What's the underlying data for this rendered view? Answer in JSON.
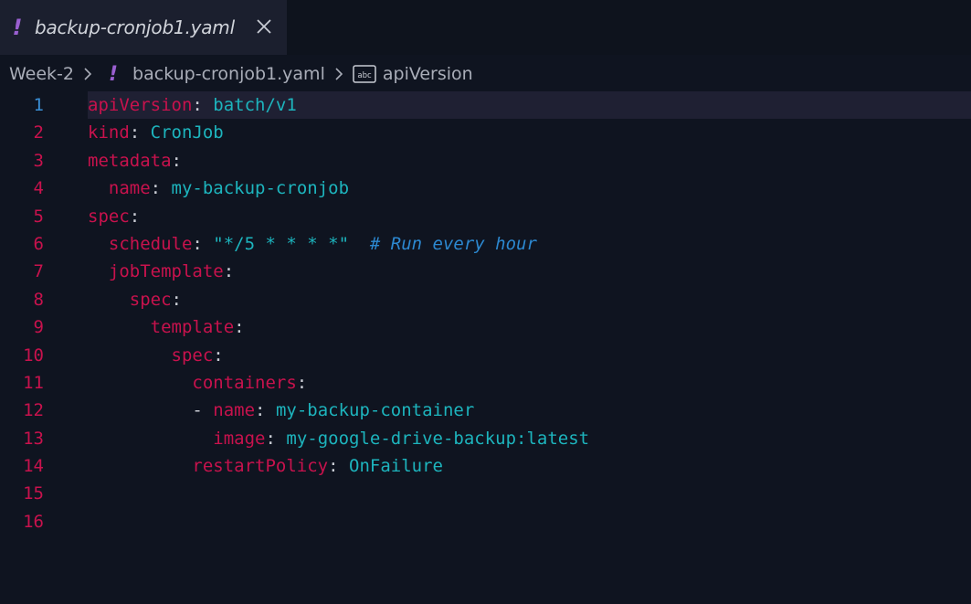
{
  "tab": {
    "icon": "yaml-file-icon",
    "glyph": "!",
    "title": "backup-cronjob1.yaml",
    "close_icon": "close-icon"
  },
  "breadcrumb": {
    "folder": "Week-2",
    "file_glyph": "!",
    "file": "backup-cronjob1.yaml",
    "symbol_icon": "string-symbol-icon",
    "symbol": "apiVersion"
  },
  "colors": {
    "key": "#c8124d",
    "value": "#1db4bd",
    "comment": "#2c88d0",
    "current_line_number": "#3a8fd6",
    "tab_icon": "#9a5fd0",
    "background": "#0f1420"
  },
  "editor": {
    "current_line": 1,
    "lines": [
      {
        "num": "1",
        "indent": "",
        "dash": "",
        "key": "apiVersion",
        "sep": ": ",
        "val": "batch/v1",
        "comment": ""
      },
      {
        "num": "2",
        "indent": "",
        "dash": "",
        "key": "kind",
        "sep": ": ",
        "val": "CronJob",
        "comment": ""
      },
      {
        "num": "3",
        "indent": "",
        "dash": "",
        "key": "metadata",
        "sep": ":",
        "val": "",
        "comment": ""
      },
      {
        "num": "4",
        "indent": "  ",
        "dash": "",
        "key": "name",
        "sep": ": ",
        "val": "my-backup-cronjob",
        "comment": ""
      },
      {
        "num": "5",
        "indent": "",
        "dash": "",
        "key": "spec",
        "sep": ":",
        "val": "",
        "comment": ""
      },
      {
        "num": "6",
        "indent": "  ",
        "dash": "",
        "key": "schedule",
        "sep": ": ",
        "val": "\"*/5 * * * *\"",
        "comment": "  # Run every hour"
      },
      {
        "num": "7",
        "indent": "  ",
        "dash": "",
        "key": "jobTemplate",
        "sep": ":",
        "val": "",
        "comment": ""
      },
      {
        "num": "8",
        "indent": "    ",
        "dash": "",
        "key": "spec",
        "sep": ":",
        "val": "",
        "comment": ""
      },
      {
        "num": "9",
        "indent": "      ",
        "dash": "",
        "key": "template",
        "sep": ":",
        "val": "",
        "comment": ""
      },
      {
        "num": "10",
        "indent": "        ",
        "dash": "",
        "key": "spec",
        "sep": ":",
        "val": "",
        "comment": ""
      },
      {
        "num": "11",
        "indent": "          ",
        "dash": "",
        "key": "containers",
        "sep": ":",
        "val": "",
        "comment": ""
      },
      {
        "num": "12",
        "indent": "          ",
        "dash": "- ",
        "key": "name",
        "sep": ": ",
        "val": "my-backup-container",
        "comment": ""
      },
      {
        "num": "13",
        "indent": "            ",
        "dash": "",
        "key": "image",
        "sep": ": ",
        "val": "my-google-drive-backup:latest",
        "comment": ""
      },
      {
        "num": "14",
        "indent": "          ",
        "dash": "",
        "key": "restartPolicy",
        "sep": ": ",
        "val": "OnFailure",
        "comment": ""
      },
      {
        "num": "15",
        "indent": "",
        "dash": "",
        "key": "",
        "sep": "",
        "val": "",
        "comment": ""
      },
      {
        "num": "16",
        "indent": "",
        "dash": "",
        "key": "",
        "sep": "",
        "val": "",
        "comment": ""
      }
    ]
  }
}
